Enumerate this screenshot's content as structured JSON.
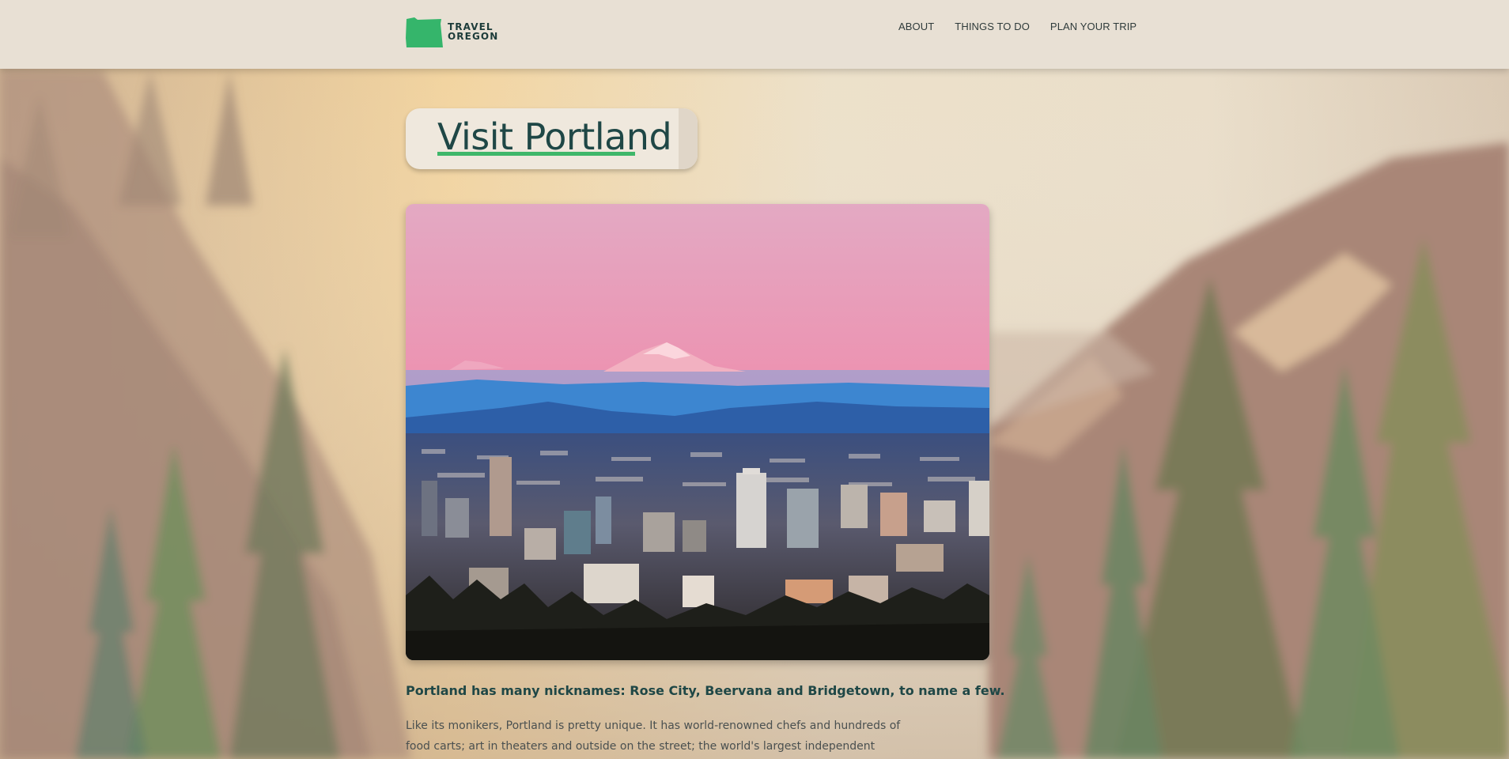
{
  "header": {
    "logo": {
      "line1": "TRAVEL",
      "line2": "OREGON",
      "brand_color": "#35b56b"
    },
    "nav": [
      {
        "label": "ABOUT"
      },
      {
        "label": "THINGS TO DO"
      },
      {
        "label": "PLAN YOUR TRIP"
      }
    ]
  },
  "main": {
    "title": "Visit Portland",
    "hero_image": {
      "icon": "portland-skyline-mt-hood-photo"
    },
    "lead": "Portland has many nicknames: Rose City, Beervana and Bridgetown, to name a few.",
    "body": "Like its monikers, Portland is pretty unique. It has world-renowned chefs and hundreds of food carts; art in theaters and outside on the street; the world's largest independent bookstore and"
  },
  "colors": {
    "accent": "#3fb76a",
    "heading": "#1f4746",
    "header_bg": "#e8e0d4"
  }
}
